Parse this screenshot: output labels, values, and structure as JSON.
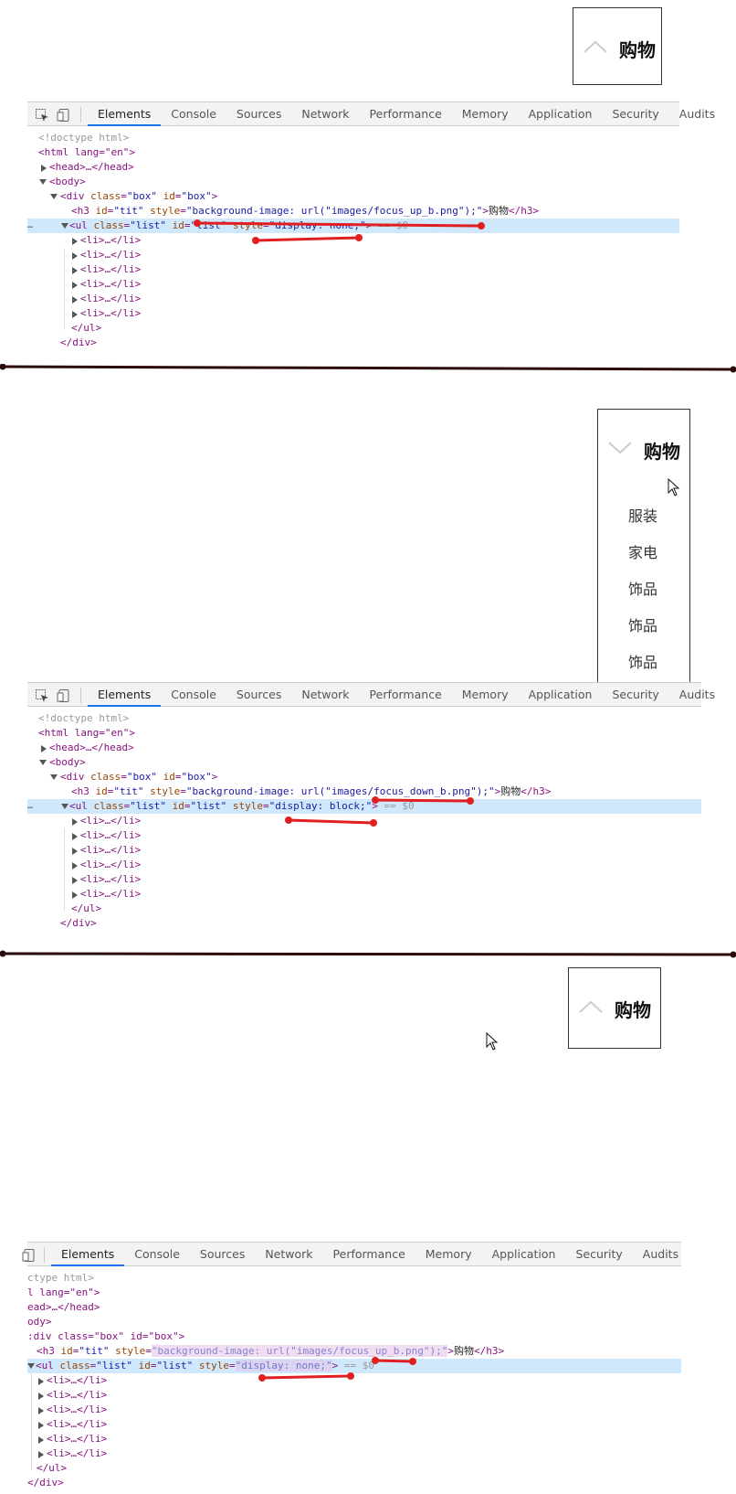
{
  "devtools": {
    "tabs": [
      "Elements",
      "Console",
      "Sources",
      "Network",
      "Performance",
      "Memory",
      "Application",
      "Security",
      "Audits"
    ],
    "active_tab": "Elements"
  },
  "demo": {
    "title": "购物",
    "items": [
      "服装",
      "家电",
      "饰品",
      "饰品",
      "饰品"
    ]
  },
  "code": {
    "doctype": "<!doctype html>",
    "html_open": "<html lang=\"en\">",
    "head": "<head>…</head>",
    "body_open": "<body>",
    "div_open_tag": "div",
    "div_class_attr": "class",
    "div_class_val": "\"box\"",
    "div_id_attr": "id",
    "div_id_val": "\"box\"",
    "h3_tag": "h3",
    "h3_id_attr": "id",
    "h3_id_val": "\"tit\"",
    "style_attr": "style",
    "h3_style_up": "\"background-image: url(\"images/focus_up_b.png\");\"",
    "h3_style_down": "\"background-image: url(\"images/focus_down_b.png\");\"",
    "h3_text": "购物",
    "h3_close": "</h3>",
    "ul_tag": "ul",
    "ul_class_val": "\"list\"",
    "ul_id_val": "\"list\"",
    "ul_style_none": "\"display: none;\"",
    "ul_style_block": "\"display: block;\"",
    "selected_marker": " == $0",
    "li": "<li>…</li>",
    "ul_close": "</ul>",
    "div_close": "</div>",
    "ellipsis": "…",
    "trunc_html": "l lang=\"en\">",
    "trunc_head": "ead>…</head>",
    "trunc_body": "ody>",
    "trunc_div": ":div class=\"box\" id=\"box\">",
    "trunc_doctype": "ctype html>"
  },
  "colors": {
    "annotation_red": "#e02020",
    "selection": "#cfe8fc",
    "active_tab_underline": "#1a73e8",
    "divider": "#2a0a0a"
  },
  "icons": [
    "inspect-icon",
    "device-toggle-icon",
    "chevron-up-icon",
    "chevron-down-icon",
    "mouse-cursor-icon"
  ]
}
